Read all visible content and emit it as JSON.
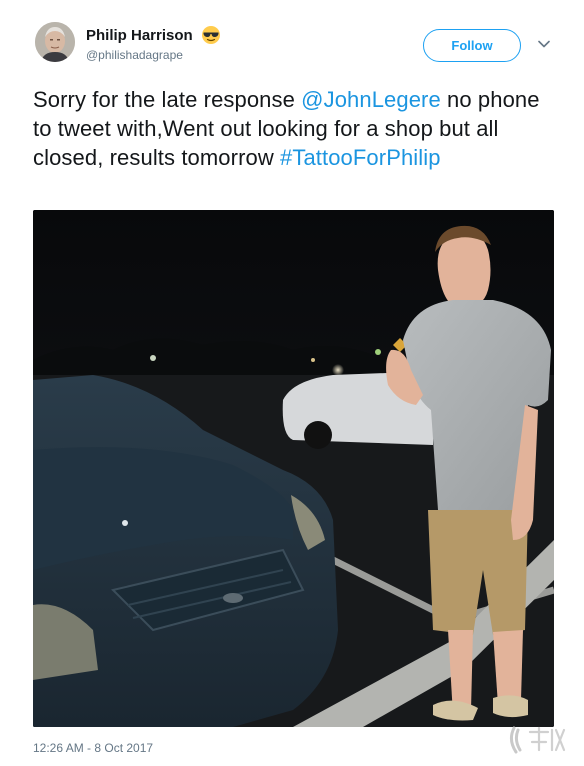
{
  "tweet": {
    "author": {
      "display_name": "Philip Harrison",
      "handle": "@philishadagrape",
      "avatar_icon": "profile-photo",
      "name_emoji": "sunglasses-emoji"
    },
    "follow_label": "Follow",
    "text_segments": [
      {
        "type": "text",
        "value": "Sorry for the late response "
      },
      {
        "type": "mention",
        "value": "@JohnLegere"
      },
      {
        "type": "text",
        "value": " no phone to tweet with,Went out looking for a shop but all closed, results tomorrow "
      },
      {
        "type": "hashtag",
        "value": "#TattooForPhilip"
      }
    ],
    "timestamp": "12:26 AM - 8 Oct 2017"
  },
  "colors": {
    "link": "#1b95e0",
    "follow": "#1da1f2",
    "secondary_text": "#657786"
  }
}
